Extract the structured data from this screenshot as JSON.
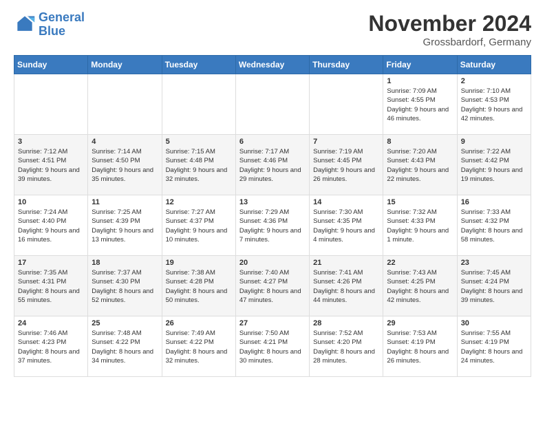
{
  "logo": {
    "line1": "General",
    "line2": "Blue"
  },
  "title": "November 2024",
  "subtitle": "Grossbardorf, Germany",
  "days_of_week": [
    "Sunday",
    "Monday",
    "Tuesday",
    "Wednesday",
    "Thursday",
    "Friday",
    "Saturday"
  ],
  "weeks": [
    [
      {
        "day": "",
        "info": ""
      },
      {
        "day": "",
        "info": ""
      },
      {
        "day": "",
        "info": ""
      },
      {
        "day": "",
        "info": ""
      },
      {
        "day": "",
        "info": ""
      },
      {
        "day": "1",
        "info": "Sunrise: 7:09 AM\nSunset: 4:55 PM\nDaylight: 9 hours and 46 minutes."
      },
      {
        "day": "2",
        "info": "Sunrise: 7:10 AM\nSunset: 4:53 PM\nDaylight: 9 hours and 42 minutes."
      }
    ],
    [
      {
        "day": "3",
        "info": "Sunrise: 7:12 AM\nSunset: 4:51 PM\nDaylight: 9 hours and 39 minutes."
      },
      {
        "day": "4",
        "info": "Sunrise: 7:14 AM\nSunset: 4:50 PM\nDaylight: 9 hours and 35 minutes."
      },
      {
        "day": "5",
        "info": "Sunrise: 7:15 AM\nSunset: 4:48 PM\nDaylight: 9 hours and 32 minutes."
      },
      {
        "day": "6",
        "info": "Sunrise: 7:17 AM\nSunset: 4:46 PM\nDaylight: 9 hours and 29 minutes."
      },
      {
        "day": "7",
        "info": "Sunrise: 7:19 AM\nSunset: 4:45 PM\nDaylight: 9 hours and 26 minutes."
      },
      {
        "day": "8",
        "info": "Sunrise: 7:20 AM\nSunset: 4:43 PM\nDaylight: 9 hours and 22 minutes."
      },
      {
        "day": "9",
        "info": "Sunrise: 7:22 AM\nSunset: 4:42 PM\nDaylight: 9 hours and 19 minutes."
      }
    ],
    [
      {
        "day": "10",
        "info": "Sunrise: 7:24 AM\nSunset: 4:40 PM\nDaylight: 9 hours and 16 minutes."
      },
      {
        "day": "11",
        "info": "Sunrise: 7:25 AM\nSunset: 4:39 PM\nDaylight: 9 hours and 13 minutes."
      },
      {
        "day": "12",
        "info": "Sunrise: 7:27 AM\nSunset: 4:37 PM\nDaylight: 9 hours and 10 minutes."
      },
      {
        "day": "13",
        "info": "Sunrise: 7:29 AM\nSunset: 4:36 PM\nDaylight: 9 hours and 7 minutes."
      },
      {
        "day": "14",
        "info": "Sunrise: 7:30 AM\nSunset: 4:35 PM\nDaylight: 9 hours and 4 minutes."
      },
      {
        "day": "15",
        "info": "Sunrise: 7:32 AM\nSunset: 4:33 PM\nDaylight: 9 hours and 1 minute."
      },
      {
        "day": "16",
        "info": "Sunrise: 7:33 AM\nSunset: 4:32 PM\nDaylight: 8 hours and 58 minutes."
      }
    ],
    [
      {
        "day": "17",
        "info": "Sunrise: 7:35 AM\nSunset: 4:31 PM\nDaylight: 8 hours and 55 minutes."
      },
      {
        "day": "18",
        "info": "Sunrise: 7:37 AM\nSunset: 4:30 PM\nDaylight: 8 hours and 52 minutes."
      },
      {
        "day": "19",
        "info": "Sunrise: 7:38 AM\nSunset: 4:28 PM\nDaylight: 8 hours and 50 minutes."
      },
      {
        "day": "20",
        "info": "Sunrise: 7:40 AM\nSunset: 4:27 PM\nDaylight: 8 hours and 47 minutes."
      },
      {
        "day": "21",
        "info": "Sunrise: 7:41 AM\nSunset: 4:26 PM\nDaylight: 8 hours and 44 minutes."
      },
      {
        "day": "22",
        "info": "Sunrise: 7:43 AM\nSunset: 4:25 PM\nDaylight: 8 hours and 42 minutes."
      },
      {
        "day": "23",
        "info": "Sunrise: 7:45 AM\nSunset: 4:24 PM\nDaylight: 8 hours and 39 minutes."
      }
    ],
    [
      {
        "day": "24",
        "info": "Sunrise: 7:46 AM\nSunset: 4:23 PM\nDaylight: 8 hours and 37 minutes."
      },
      {
        "day": "25",
        "info": "Sunrise: 7:48 AM\nSunset: 4:22 PM\nDaylight: 8 hours and 34 minutes."
      },
      {
        "day": "26",
        "info": "Sunrise: 7:49 AM\nSunset: 4:22 PM\nDaylight: 8 hours and 32 minutes."
      },
      {
        "day": "27",
        "info": "Sunrise: 7:50 AM\nSunset: 4:21 PM\nDaylight: 8 hours and 30 minutes."
      },
      {
        "day": "28",
        "info": "Sunrise: 7:52 AM\nSunset: 4:20 PM\nDaylight: 8 hours and 28 minutes."
      },
      {
        "day": "29",
        "info": "Sunrise: 7:53 AM\nSunset: 4:19 PM\nDaylight: 8 hours and 26 minutes."
      },
      {
        "day": "30",
        "info": "Sunrise: 7:55 AM\nSunset: 4:19 PM\nDaylight: 8 hours and 24 minutes."
      }
    ]
  ]
}
